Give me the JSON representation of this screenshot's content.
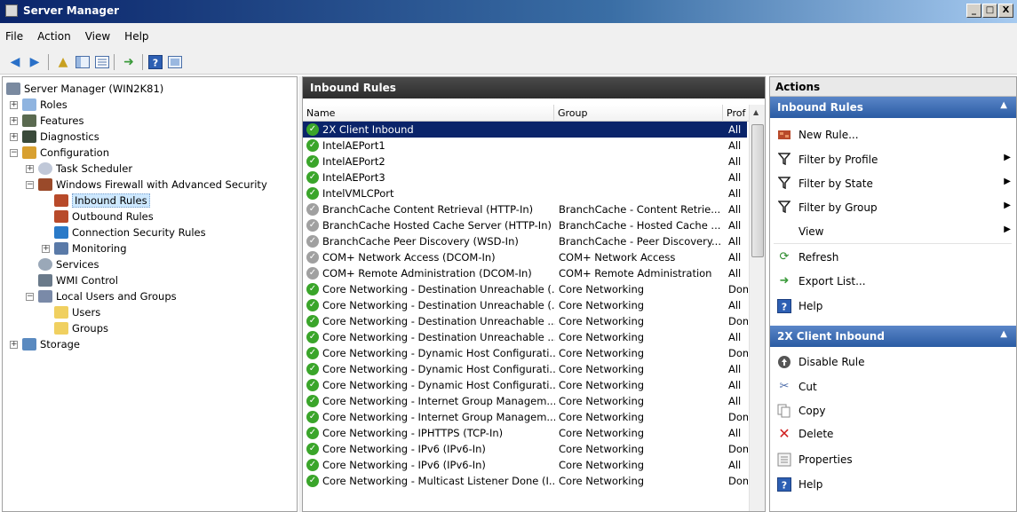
{
  "window": {
    "title": "Server Manager",
    "min": "_",
    "max": "□",
    "close": "X"
  },
  "menu": [
    "File",
    "Action",
    "View",
    "Help"
  ],
  "tree": {
    "items": [
      {
        "label": "Server Manager (WIN2K81)",
        "icon": "server-icon"
      },
      {
        "label": "Roles",
        "icon": "roles-icon"
      },
      {
        "label": "Features",
        "icon": "features-icon"
      },
      {
        "label": "Diagnostics",
        "icon": "diagnostics-icon"
      },
      {
        "label": "Configuration",
        "icon": "configuration-icon"
      },
      {
        "label": "Task Scheduler",
        "icon": "clock-icon"
      },
      {
        "label": "Windows Firewall with Advanced Security",
        "icon": "firewall-icon"
      },
      {
        "label": "Inbound Rules",
        "icon": "inbound-rules-icon"
      },
      {
        "label": "Outbound Rules",
        "icon": "outbound-rules-icon"
      },
      {
        "label": "Connection Security Rules",
        "icon": "connection-security-icon"
      },
      {
        "label": "Monitoring",
        "icon": "monitoring-icon"
      },
      {
        "label": "Services",
        "icon": "services-icon"
      },
      {
        "label": "WMI Control",
        "icon": "wmi-icon"
      },
      {
        "label": "Local Users and Groups",
        "icon": "users-groups-icon"
      },
      {
        "label": "Users",
        "icon": "folder-icon"
      },
      {
        "label": "Groups",
        "icon": "folder-icon"
      },
      {
        "label": "Storage",
        "icon": "storage-icon"
      }
    ]
  },
  "center": {
    "title": "Inbound Rules",
    "columns": [
      "Name",
      "Group",
      "Prof"
    ],
    "sort_indicator": "▲",
    "rows": [
      {
        "name": "2X Client Inbound",
        "group": "",
        "profile": "All",
        "status": "enabled"
      },
      {
        "name": "IntelAEPort1",
        "group": "",
        "profile": "All",
        "status": "enabled"
      },
      {
        "name": "IntelAEPort2",
        "group": "",
        "profile": "All",
        "status": "enabled"
      },
      {
        "name": "IntelAEPort3",
        "group": "",
        "profile": "All",
        "status": "enabled"
      },
      {
        "name": "IntelVMLCPort",
        "group": "",
        "profile": "All",
        "status": "enabled"
      },
      {
        "name": "BranchCache Content Retrieval (HTTP-In)",
        "group": "BranchCache - Content Retrie...",
        "profile": "All",
        "status": "disabled"
      },
      {
        "name": "BranchCache Hosted Cache Server (HTTP-In)",
        "group": "BranchCache - Hosted Cache ...",
        "profile": "All",
        "status": "disabled"
      },
      {
        "name": "BranchCache Peer Discovery (WSD-In)",
        "group": "BranchCache - Peer Discovery...",
        "profile": "All",
        "status": "disabled"
      },
      {
        "name": "COM+ Network Access (DCOM-In)",
        "group": "COM+ Network Access",
        "profile": "All",
        "status": "disabled"
      },
      {
        "name": "COM+ Remote Administration (DCOM-In)",
        "group": "COM+ Remote Administration",
        "profile": "All",
        "status": "disabled"
      },
      {
        "name": "Core Networking - Destination Unreachable (...",
        "group": "Core Networking",
        "profile": "Dom",
        "status": "enabled"
      },
      {
        "name": "Core Networking - Destination Unreachable (...",
        "group": "Core Networking",
        "profile": "All",
        "status": "enabled"
      },
      {
        "name": "Core Networking - Destination Unreachable ...",
        "group": "Core Networking",
        "profile": "Dom",
        "status": "enabled"
      },
      {
        "name": "Core Networking - Destination Unreachable ...",
        "group": "Core Networking",
        "profile": "All",
        "status": "enabled"
      },
      {
        "name": "Core Networking - Dynamic Host Configurati...",
        "group": "Core Networking",
        "profile": "Dom",
        "status": "enabled"
      },
      {
        "name": "Core Networking - Dynamic Host Configurati...",
        "group": "Core Networking",
        "profile": "All",
        "status": "enabled"
      },
      {
        "name": "Core Networking - Dynamic Host Configurati...",
        "group": "Core Networking",
        "profile": "All",
        "status": "enabled"
      },
      {
        "name": "Core Networking - Internet Group Managem...",
        "group": "Core Networking",
        "profile": "All",
        "status": "enabled"
      },
      {
        "name": "Core Networking - Internet Group Managem...",
        "group": "Core Networking",
        "profile": "Dom",
        "status": "enabled"
      },
      {
        "name": "Core Networking - IPHTTPS (TCP-In)",
        "group": "Core Networking",
        "profile": "All",
        "status": "enabled"
      },
      {
        "name": "Core Networking - IPv6 (IPv6-In)",
        "group": "Core Networking",
        "profile": "Dom",
        "status": "enabled"
      },
      {
        "name": "Core Networking - IPv6 (IPv6-In)",
        "group": "Core Networking",
        "profile": "All",
        "status": "enabled"
      },
      {
        "name": "Core Networking - Multicast Listener Done (I...",
        "group": "Core Networking",
        "profile": "Dom",
        "status": "enabled"
      }
    ]
  },
  "actions": {
    "title": "Actions",
    "section1": {
      "title": "Inbound Rules",
      "items": [
        {
          "label": "New Rule...",
          "icon": "new-rule-icon"
        },
        {
          "label": "Filter by Profile",
          "icon": "filter-icon"
        },
        {
          "label": "Filter by State",
          "icon": "filter-icon"
        },
        {
          "label": "Filter by Group",
          "icon": "filter-icon"
        },
        {
          "label": "View",
          "icon": ""
        },
        {
          "label": "Refresh",
          "icon": "refresh-icon"
        },
        {
          "label": "Export List...",
          "icon": "export-icon"
        },
        {
          "label": "Help",
          "icon": "help-icon"
        }
      ]
    },
    "section2": {
      "title": "2X Client Inbound",
      "items": [
        {
          "label": "Disable Rule",
          "icon": "disable-icon"
        },
        {
          "label": "Cut",
          "icon": "cut-icon"
        },
        {
          "label": "Copy",
          "icon": "copy-icon"
        },
        {
          "label": "Delete",
          "icon": "delete-icon"
        },
        {
          "label": "Properties",
          "icon": "properties-icon"
        },
        {
          "label": "Help",
          "icon": "help-icon"
        }
      ]
    }
  },
  "colors": {
    "selection": "#0a246a",
    "enabled": "#3aa52a",
    "disabled": "#a0a0a0",
    "section_header": "#2a5ba3"
  }
}
